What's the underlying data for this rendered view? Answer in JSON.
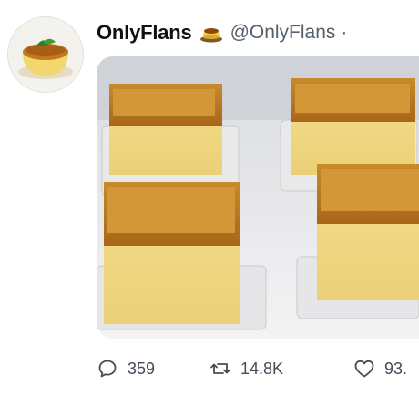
{
  "tweet": {
    "display_name": "OnlyFlans",
    "handle": "@OnlyFlans",
    "separator": "·",
    "name_emoji": "flan-emoji",
    "avatar_icon": "flan-avatar",
    "photo_subject": "photo"
  },
  "actions": {
    "reply_count": "359",
    "retweet_count": "14.8K",
    "like_count": "93."
  },
  "colors": {
    "caramel": "#c98a2c",
    "custard": "#f0d57a",
    "text": "#111111",
    "muted": "#55606b"
  }
}
